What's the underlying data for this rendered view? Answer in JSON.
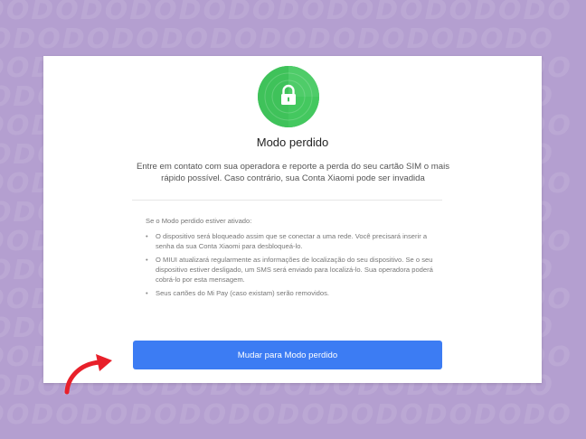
{
  "watermark": {
    "text": "DODODODODODODODODODODODO"
  },
  "card": {
    "icon": "lock-icon",
    "title": "Modo perdido",
    "subtitle": "Entre em contato com sua operadora e reporte a perda do seu cartão SIM o mais rápido possível. Caso contrário, sua Conta Xiaomi pode ser invadida",
    "details_heading": "Se o Modo perdido estiver ativado:",
    "details_items": [
      "O dispositivo será bloqueado assim que se conectar a uma rede. Você precisará inserir a senha da sua Conta Xiaomi para desbloqueá-lo.",
      "O MIUI atualizará regularmente as informações de localização do seu dispositivo. Se o seu dispositivo estiver desligado, um SMS será enviado para localizá-lo. Sua operadora poderá cobrá-lo por esta mensagem.",
      "Seus cartões do Mi Pay (caso existam) serão removidos."
    ],
    "button_label": "Mudar para Modo perdido"
  },
  "colors": {
    "background": "#b49fd0",
    "accent_green": "#3fc25a",
    "button_blue": "#3c7cf3",
    "arrow_red": "#e8202a"
  },
  "annotation": {
    "icon": "curved-arrow-icon"
  }
}
